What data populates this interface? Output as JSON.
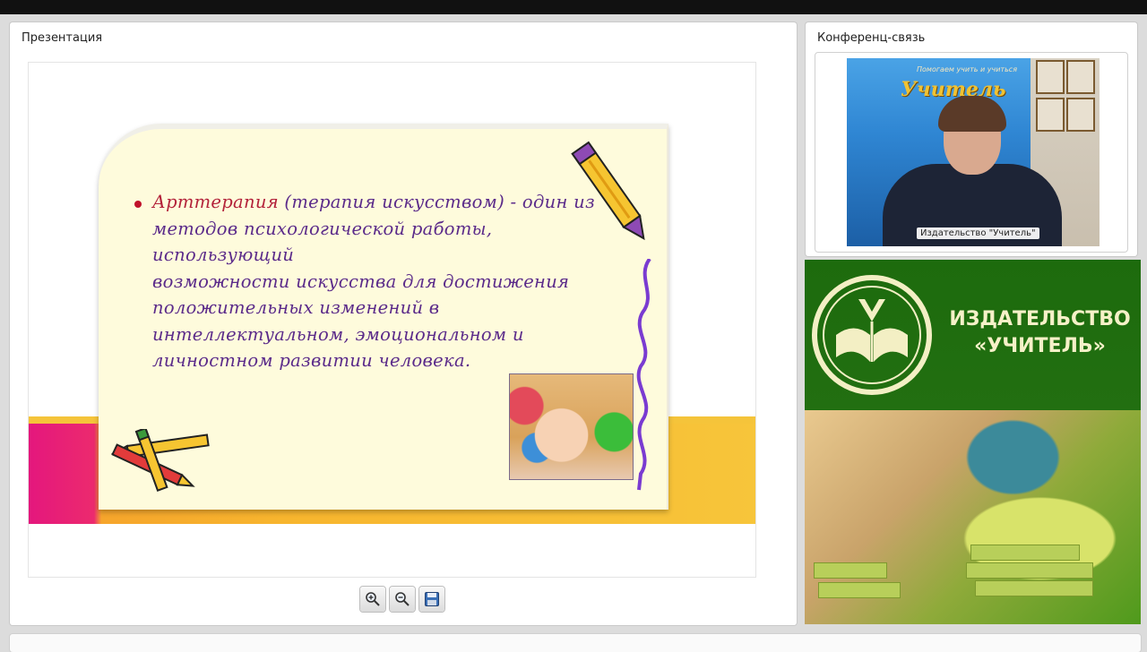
{
  "presentation": {
    "title": "Презентация",
    "slide": {
      "term": "Арттерапия",
      "text_lines": [
        " (терапия искусством) - один из",
        "методов психологической работы, использующий",
        "возможности искусства для достижения",
        "положительных изменений в",
        "интеллектуальном, эмоциональном и",
        "личностном развитии человека."
      ]
    },
    "toolbar": {
      "zoom_in_icon": "zoom-in-icon",
      "zoom_out_icon": "zoom-out-icon",
      "save_icon": "floppy-disk-icon"
    }
  },
  "conference": {
    "title": "Конференц-связь",
    "video": {
      "participant_label": "Издательство \"Учитель\"",
      "banner_slogan": "Помогаем учить и учиться",
      "banner_logo": "Учитель"
    }
  },
  "publisher": {
    "name_line1": "ИЗДАТЕЛЬСТВО",
    "name_line2": "«УЧИТЕЛЬ»",
    "brand_color": "#1f6e0f",
    "text_color": "#f6f1c8"
  }
}
